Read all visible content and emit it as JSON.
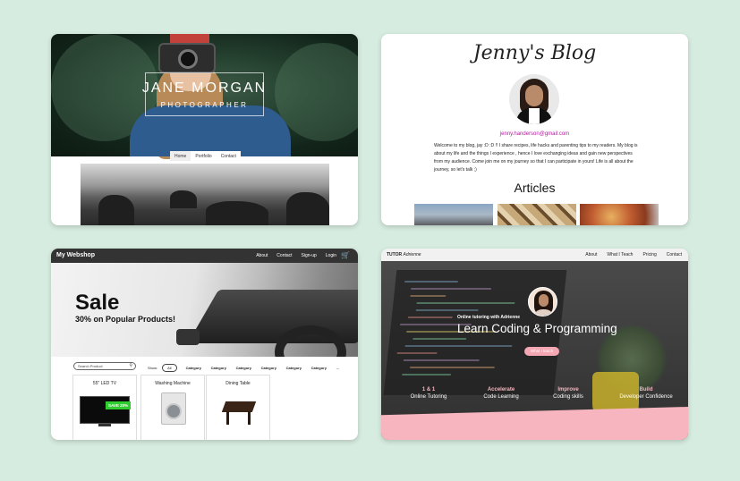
{
  "jane": {
    "name": "JANE MORGAN",
    "subtitle": "PHOTOGRAPHER",
    "nav": [
      "Home",
      "Portfolio",
      "Contact"
    ]
  },
  "jenny": {
    "title": "Jenny's Blog",
    "email": "jenny.handerson@gmail.com",
    "intro": "Welcome to my blog, jay :D :D !! I share recipes, life hacks and parenting tips to my readers. My blog is about my life and the things I experience , hence I love exchanging ideas and gain new perspectives from my audience. Come join me on my journey so that I can participate in yours! Life is all about the journey, so let's talk ;)",
    "articles_heading": "Articles"
  },
  "shop": {
    "brand": "My Webshop",
    "nav": [
      "About",
      "Contact",
      "Sign-up",
      "Login"
    ],
    "cart_icon": "cart-icon",
    "sale_title": "Sale",
    "sale_subtitle": "30% on Popular Products!",
    "search_placeholder": "Search Product",
    "filter_show": "Show:",
    "filter_all": "All",
    "categories": [
      "Category",
      "Category",
      "Category",
      "Category",
      "Category",
      "Category",
      "..."
    ],
    "products": [
      {
        "name": "55\" LED TV",
        "badge": "SAVE 20%"
      },
      {
        "name": "Washing Machine"
      },
      {
        "name": "Dining Table"
      }
    ]
  },
  "tutor": {
    "brand_bold": "TUTOR",
    "brand_italic": "Adrienne",
    "nav": [
      "About",
      "What I Teach",
      "Pricing",
      "Contact"
    ],
    "kicker": "Online tutoring with Adrienne",
    "title": "Learn Coding & Programming",
    "button": "What I teach",
    "features": [
      {
        "top": "1 & 1",
        "bottom": "Online Tutoring"
      },
      {
        "top": "Accelerate",
        "bottom": "Code Learning"
      },
      {
        "top": "Improve",
        "bottom": "Coding skills"
      },
      {
        "top": "Build",
        "bottom": "Developer Confidence"
      }
    ],
    "accent": "#f7b6bf"
  }
}
